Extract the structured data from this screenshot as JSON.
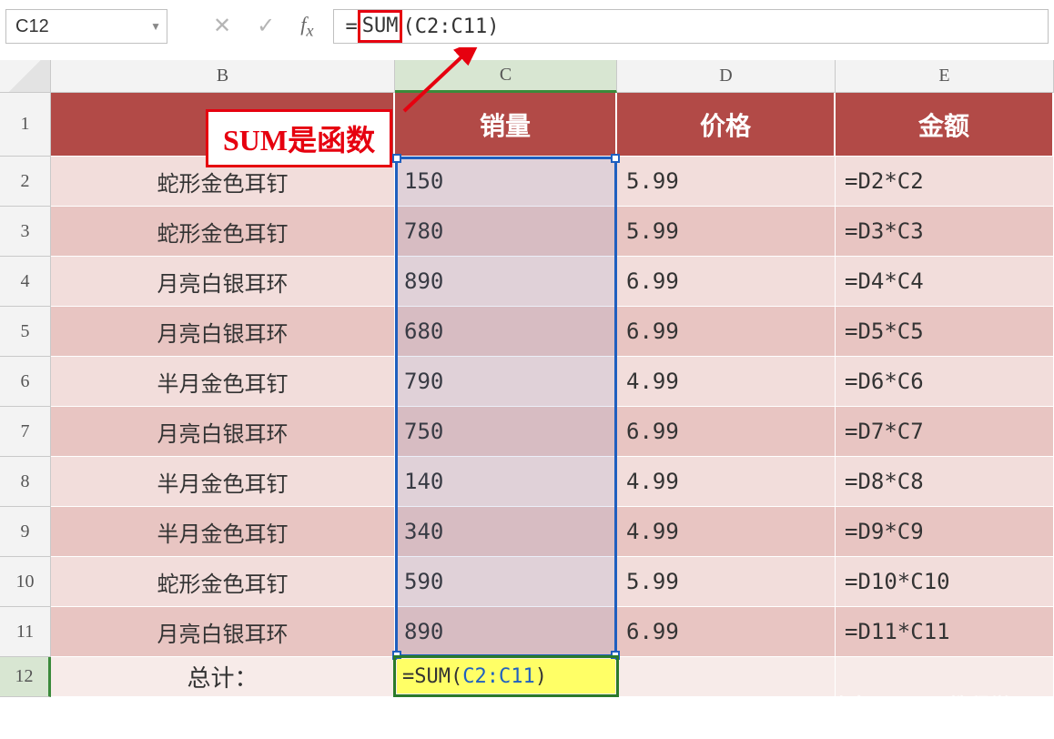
{
  "nameBox": "C12",
  "formulaBar": {
    "prefix": "=",
    "boxed": "SUM",
    "suffix": "(C2:C11)"
  },
  "columns": [
    "B",
    "C",
    "D",
    "E"
  ],
  "headerRow": {
    "b": "",
    "c": "销量",
    "d": "价格",
    "e": "金额"
  },
  "rows": [
    {
      "n": "2",
      "b": "蛇形金色耳钉",
      "c": "150",
      "d": "5.99",
      "e": "=D2*C2"
    },
    {
      "n": "3",
      "b": "蛇形金色耳钉",
      "c": "780",
      "d": "5.99",
      "e": "=D3*C3"
    },
    {
      "n": "4",
      "b": "月亮白银耳环",
      "c": "890",
      "d": "6.99",
      "e": "=D4*C4"
    },
    {
      "n": "5",
      "b": "月亮白银耳环",
      "c": "680",
      "d": "6.99",
      "e": "=D5*C5"
    },
    {
      "n": "6",
      "b": "半月金色耳钉",
      "c": "790",
      "d": "4.99",
      "e": "=D6*C6"
    },
    {
      "n": "7",
      "b": "月亮白银耳环",
      "c": "750",
      "d": "6.99",
      "e": "=D7*C7"
    },
    {
      "n": "8",
      "b": "半月金色耳钉",
      "c": "140",
      "d": "4.99",
      "e": "=D8*C8"
    },
    {
      "n": "9",
      "b": "半月金色耳钉",
      "c": "340",
      "d": "4.99",
      "e": "=D9*C9"
    },
    {
      "n": "10",
      "b": "蛇形金色耳钉",
      "c": "590",
      "d": "5.99",
      "e": "=D10*C10"
    },
    {
      "n": "11",
      "b": "月亮白银耳环",
      "c": "890",
      "d": "6.99",
      "e": "=D11*C11"
    }
  ],
  "totalRow": {
    "n": "12",
    "b": "总计：",
    "formula": {
      "eq": "=",
      "fn": "SUM(",
      "rng": "C2:C11",
      "close": ")"
    }
  },
  "callout": "SUM是函数",
  "watermark": "头条 @Excel教程学习",
  "activeCell": "C12",
  "selectionRange": "C2:C11"
}
